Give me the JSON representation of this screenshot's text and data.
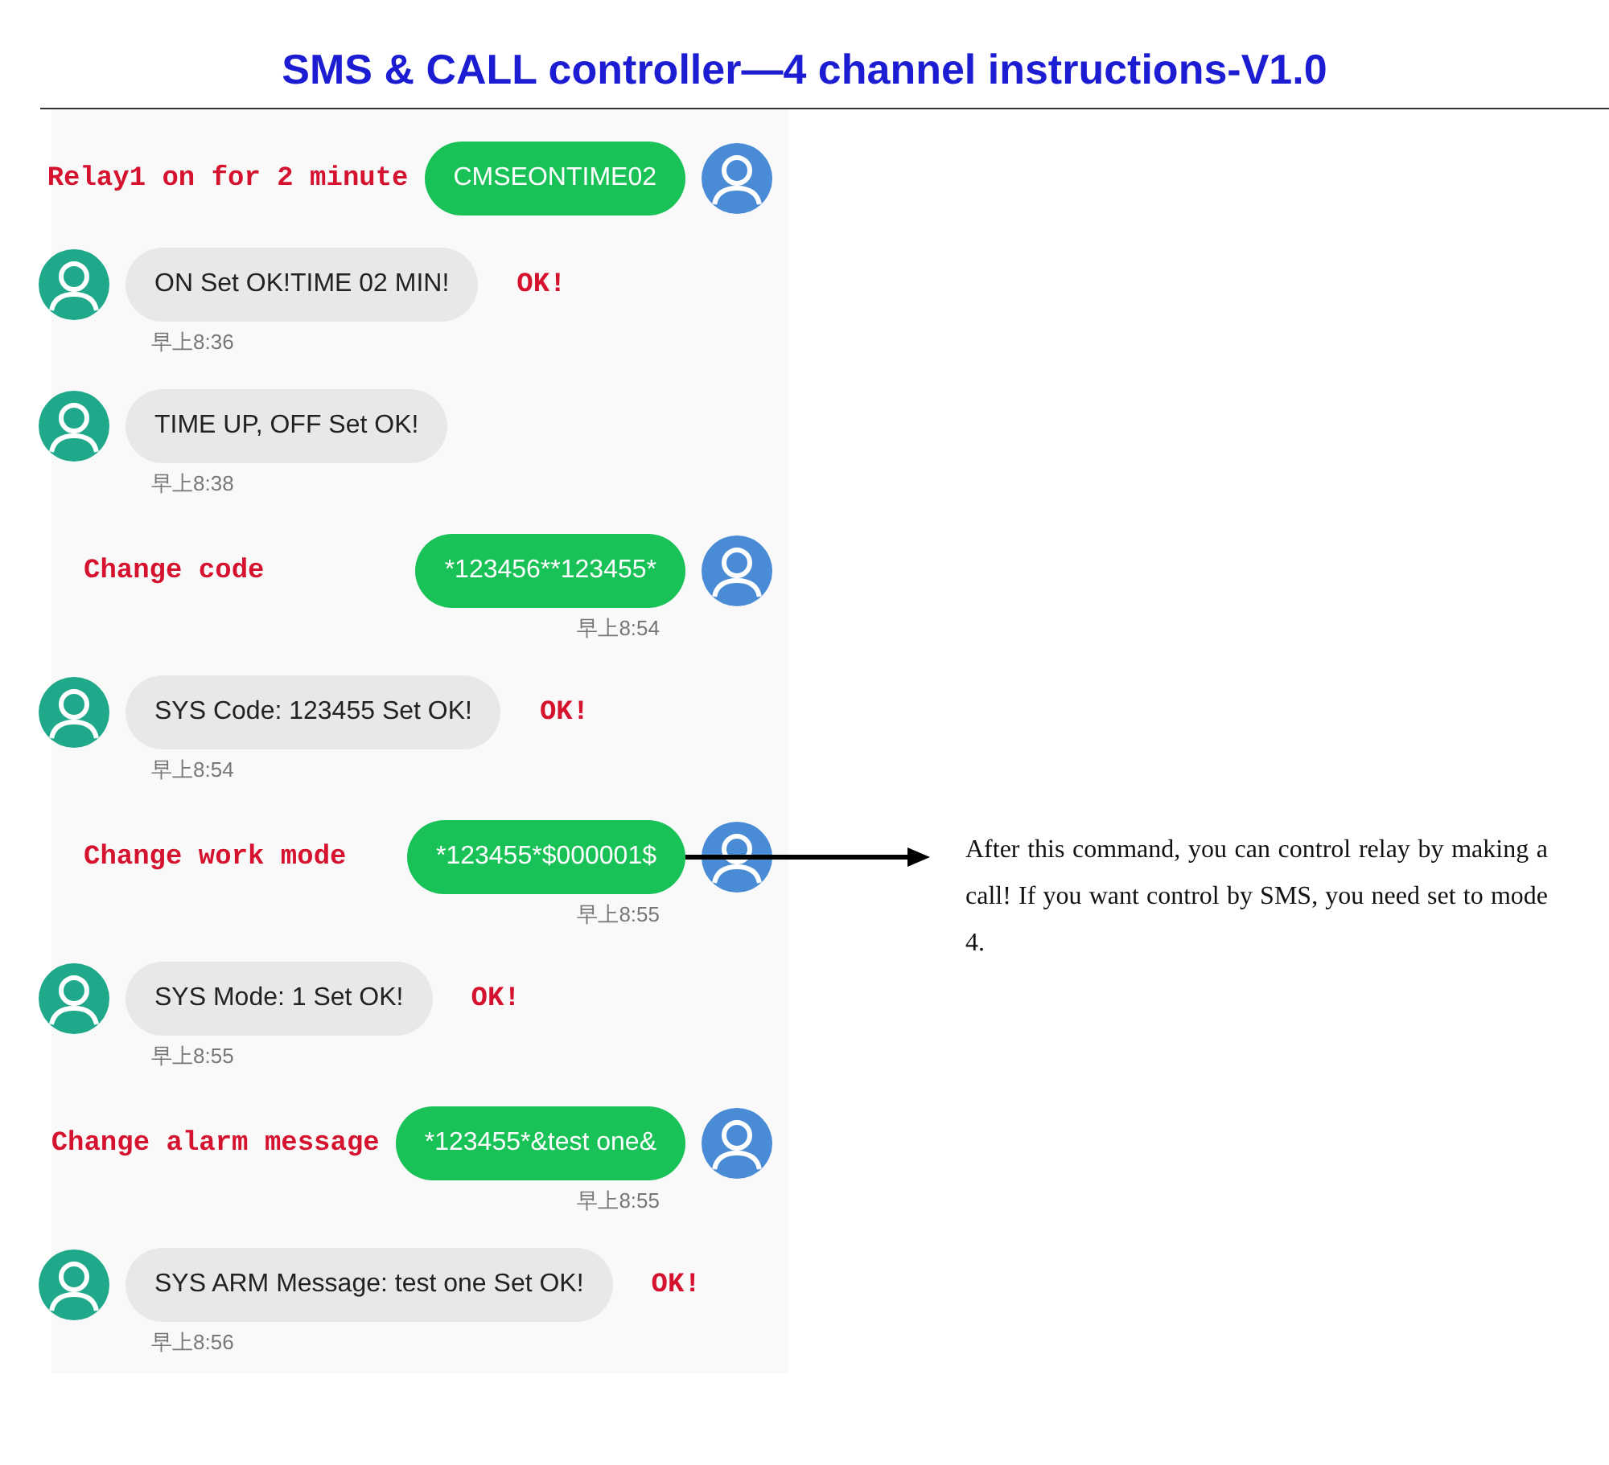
{
  "title": "SMS & CALL controller—4 channel instructions-V1.0",
  "messages": [
    {
      "kind": "sent",
      "text": "CMSEONTIME02",
      "note": "Relay1 on for 2 minute"
    },
    {
      "kind": "received",
      "text": "ON Set OK!TIME 02 MIN!",
      "note": "OK!",
      "time": "早上8:36"
    },
    {
      "kind": "received",
      "text": "TIME UP, OFF Set OK!",
      "time": "早上8:38"
    },
    {
      "kind": "sent",
      "text": "*123456**123455*",
      "note": "Change code",
      "time": "早上8:54"
    },
    {
      "kind": "received",
      "text": "SYS Code: 123455 Set OK!",
      "note": "OK!",
      "time": "早上8:54"
    },
    {
      "kind": "sent",
      "text": "*123455*$000001$",
      "note": "Change work mode",
      "time": "早上8:55",
      "arrow": true
    },
    {
      "kind": "received",
      "text": "SYS Mode: 1 Set OK!",
      "note": "OK!",
      "time": "早上8:55"
    },
    {
      "kind": "sent",
      "text": "*123455*&test one&",
      "note": "Change alarm message",
      "time": "早上8:55"
    },
    {
      "kind": "received",
      "text": "SYS ARM Message: test one Set OK!",
      "note": "OK!",
      "time": "早上8:56"
    }
  ],
  "side_note": "After this command, you can control relay by making a call! If you want control by SMS, you need set to mode 4."
}
